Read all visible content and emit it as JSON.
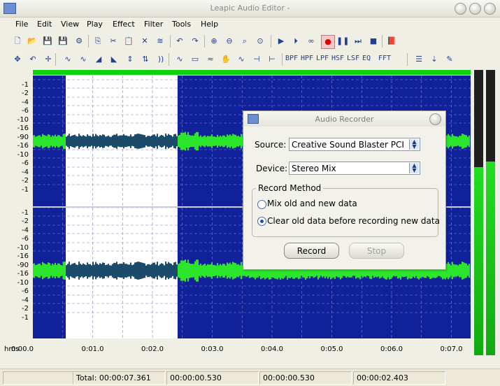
{
  "window": {
    "title": "Leapic Audio Editor -"
  },
  "menu": [
    "File",
    "Edit",
    "View",
    "Play",
    "Effect",
    "Filter",
    "Tools",
    "Help"
  ],
  "toolbar1": [
    {
      "name": "new-file-icon",
      "glyph": "🗋"
    },
    {
      "name": "open-folder-icon",
      "glyph": "📂"
    },
    {
      "name": "save-icon",
      "glyph": "💾"
    },
    {
      "name": "save-as-icon",
      "glyph": "💾"
    },
    {
      "name": "properties-icon",
      "glyph": "⚙"
    },
    {
      "name": "copy-icon",
      "glyph": "⎘"
    },
    {
      "name": "cut-icon",
      "glyph": "✂"
    },
    {
      "name": "paste-icon",
      "glyph": "📋"
    },
    {
      "name": "delete-icon",
      "glyph": "✕"
    },
    {
      "name": "trim-icon",
      "glyph": "≋"
    },
    {
      "name": "undo-icon",
      "glyph": "↶"
    },
    {
      "name": "redo-icon",
      "glyph": "↷"
    },
    {
      "name": "zoom-in-icon",
      "glyph": "⊕"
    },
    {
      "name": "zoom-out-icon",
      "glyph": "⊖"
    },
    {
      "name": "zoom-selection-icon",
      "glyph": "⌕"
    },
    {
      "name": "zoom-all-icon",
      "glyph": "⊙"
    },
    {
      "name": "play-icon",
      "glyph": "▶"
    },
    {
      "name": "play-selection-icon",
      "glyph": "⏵"
    },
    {
      "name": "loop-icon",
      "glyph": "∞"
    },
    {
      "name": "record-icon",
      "glyph": "●"
    },
    {
      "name": "pause-icon",
      "glyph": "❚❚"
    },
    {
      "name": "next-icon",
      "glyph": "⏭"
    },
    {
      "name": "stop-icon",
      "glyph": "■"
    },
    {
      "name": "book-icon",
      "glyph": "📕"
    }
  ],
  "toolbar2_icons": [
    {
      "name": "select-all-icon",
      "glyph": "✥"
    },
    {
      "name": "back-icon",
      "glyph": "↶"
    },
    {
      "name": "cursor-icon",
      "glyph": "✛"
    },
    {
      "name": "amplify-icon",
      "glyph": "∿"
    },
    {
      "name": "normalize-icon",
      "glyph": "∿"
    },
    {
      "name": "fade-in-icon",
      "glyph": "◢"
    },
    {
      "name": "fade-out-icon",
      "glyph": "◣"
    },
    {
      "name": "reverse-icon",
      "glyph": "⇕"
    },
    {
      "name": "invert-icon",
      "glyph": "⇅"
    },
    {
      "name": "echo-icon",
      "glyph": "))"
    },
    {
      "name": "silence-icon",
      "glyph": "∿"
    },
    {
      "name": "insert-silence-icon",
      "glyph": "▭"
    },
    {
      "name": "noise-icon",
      "glyph": "≈"
    },
    {
      "name": "hand-icon",
      "glyph": "✋"
    },
    {
      "name": "wave-tool-icon",
      "glyph": "∿"
    },
    {
      "name": "mute-icon",
      "glyph": "⊣"
    },
    {
      "name": "split-icon",
      "glyph": "⊢"
    }
  ],
  "toolbar2_filters": [
    "BPF",
    "HPF",
    "LPF",
    "HSF",
    "LSF",
    "EQ",
    "FFT"
  ],
  "toolbar2_end": [
    {
      "name": "list-icon",
      "glyph": "☰"
    },
    {
      "name": "mix-icon",
      "glyph": "⇣"
    },
    {
      "name": "edit-icon",
      "glyph": "✎"
    }
  ],
  "ruler_labels_top": [
    "-1",
    "-2",
    "-4",
    "-6",
    "-10",
    "-16",
    "-90",
    "-16",
    "-10",
    "-6",
    "-4",
    "-2",
    "-1"
  ],
  "ruler_labels_bottom": [
    "-1",
    "-2",
    "-4",
    "-6",
    "-10",
    "-16",
    "-90",
    "-16",
    "-10",
    "-6",
    "-4",
    "-2",
    "-1"
  ],
  "timeline": {
    "unit": "hms",
    "labels": [
      "0:00.0",
      "0:01.0",
      "0:02.0",
      "0:03.0",
      "0:04.0",
      "0:05.0",
      "0:06.0",
      "0:07.0"
    ]
  },
  "selection": {
    "start_s": 0.55,
    "end_s": 2.42
  },
  "meters": {
    "left_level": 0.66,
    "right_level": 0.68
  },
  "status": {
    "total": "Total: 00:00:07.361",
    "cell2": "00:00:00.530",
    "cell3": "00:00:00.530",
    "cell4": "00:00:02.403"
  },
  "dialog": {
    "title": "Audio Recorder",
    "source_label": "Source:",
    "source_value": "Creative Sound Blaster PCI",
    "device_label": "Device:",
    "device_value": "Stereo Mix",
    "group_title": "Record Method",
    "option1": "Mix old and new data",
    "option2": "Clear old data before recording new data",
    "selected_option": 2,
    "record_label": "Record",
    "stop_label": "Stop"
  },
  "colors": {
    "waveform_bg": "#10219a",
    "waveform": "#2ce62c",
    "selection_bg": "#ffffff",
    "selection_wave": "#1c4a6a"
  }
}
